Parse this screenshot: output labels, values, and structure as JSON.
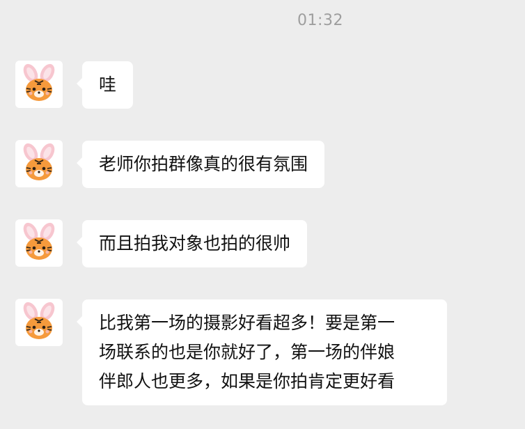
{
  "chat": {
    "timestamp": "01:32",
    "messages": [
      {
        "sender_avatar": "tiger-bunny-avatar",
        "text": "哇"
      },
      {
        "sender_avatar": "tiger-bunny-avatar",
        "text": "老师你拍群像真的很有氛围"
      },
      {
        "sender_avatar": "tiger-bunny-avatar",
        "text": "而且拍我对象也拍的很帅"
      },
      {
        "sender_avatar": "tiger-bunny-avatar",
        "lines": [
          "比我第一场的摄影好看超多！要是第一",
          "场联系的也是你就好了，第一场的伴娘",
          "伴郎人也更多，如果是你拍肯定更好看"
        ]
      }
    ]
  },
  "colors": {
    "background": "#ededed",
    "bubble": "#ffffff",
    "text": "#111111",
    "timestamp": "#9e9e9e",
    "avatar_tiger": "#f59a3c",
    "avatar_ears": "#f7c6cf"
  }
}
